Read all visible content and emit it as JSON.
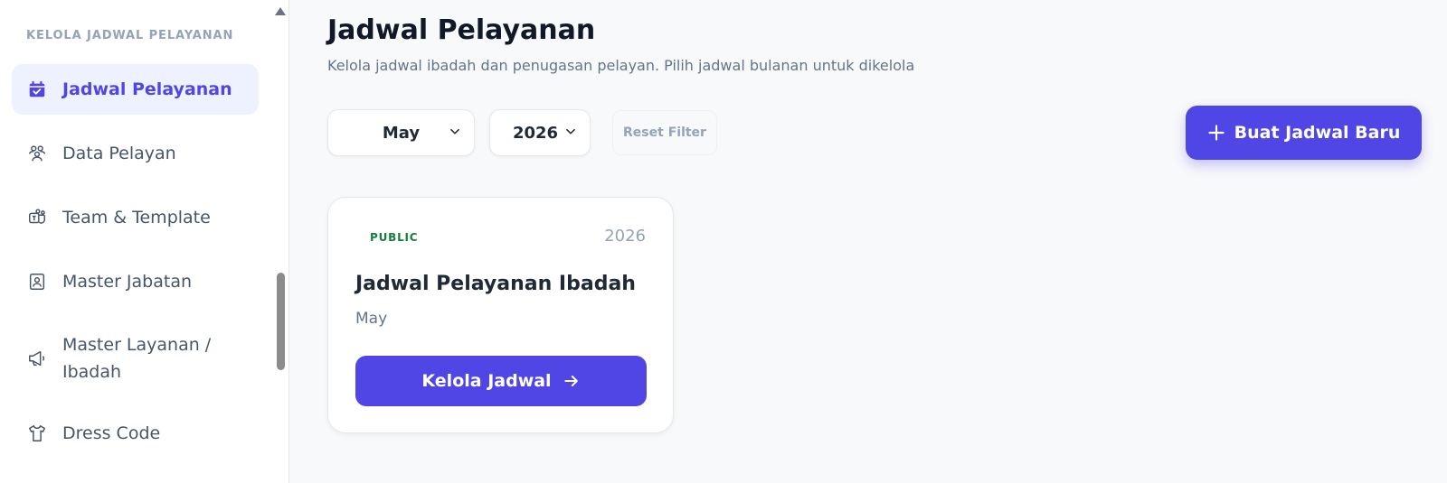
{
  "sidebar": {
    "section_label": "KELOLA JADWAL PELAYANAN",
    "items": [
      {
        "label": "Jadwal Pelayanan",
        "icon": "calendar-check-icon",
        "active": true
      },
      {
        "label": "Data Pelayan",
        "icon": "users-group-icon"
      },
      {
        "label": "Team & Template",
        "icon": "teams-icon"
      },
      {
        "label": "Master Jabatan",
        "icon": "id-badge-icon"
      },
      {
        "label": "Master Layanan /",
        "label2": "Ibadah",
        "icon": "megaphone-icon"
      },
      {
        "label": "Dress Code",
        "icon": "shirt-icon"
      }
    ]
  },
  "header": {
    "title": "Jadwal Pelayanan",
    "subtitle": "Kelola jadwal ibadah dan penugasan pelayan. Pilih jadwal bulanan untuk dikelola"
  },
  "filters": {
    "month": "May",
    "year": "2026",
    "reset_label": "Reset Filter"
  },
  "create_button": {
    "label": "Buat Jadwal Baru",
    "icon": "plus-icon"
  },
  "schedules": [
    {
      "visibility": "PUBLIC",
      "year": "2026",
      "title": "Jadwal Pelayanan Ibadah",
      "month": "May",
      "action_label": "Kelola Jadwal",
      "action_icon": "arrow-right-icon"
    }
  ],
  "colors": {
    "accent": "#4f46e5",
    "active_bg": "#eef2ff",
    "public_badge": "#15803d",
    "muted_text": "#64748b"
  }
}
